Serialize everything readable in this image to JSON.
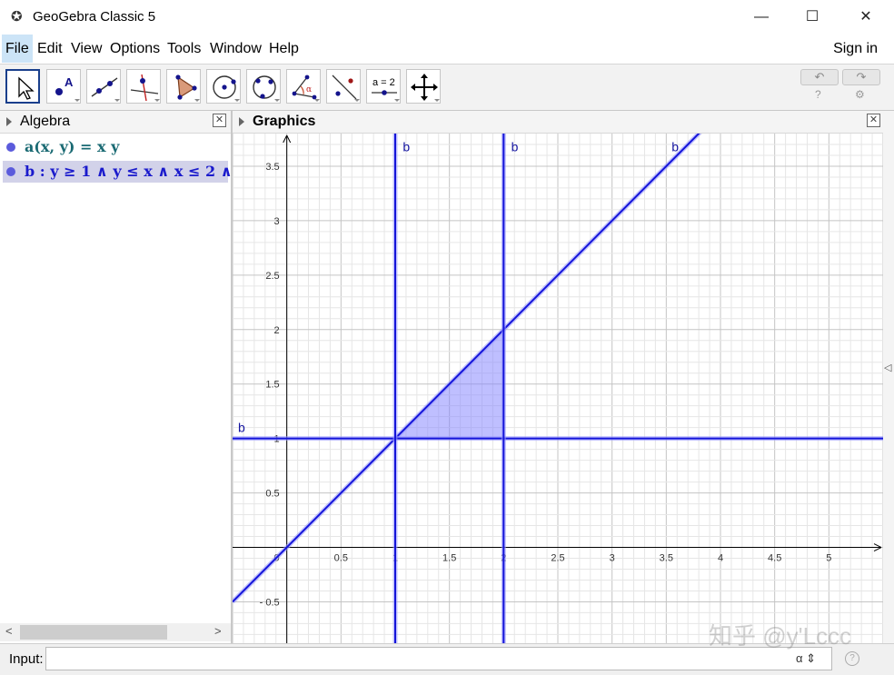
{
  "window": {
    "title": "GeoGebra Classic 5",
    "minimize": "—",
    "maximize": "☐",
    "close": "✕"
  },
  "menu": {
    "items": [
      "File",
      "Edit",
      "View",
      "Options",
      "Tools",
      "Window",
      "Help"
    ],
    "sign_in": "Sign in"
  },
  "toolbar": {
    "tools": [
      "move",
      "point",
      "line",
      "perpendicular-line",
      "polygon",
      "circle-center-point",
      "circle-three-points",
      "angle",
      "reflect",
      "slider",
      "move-graphics-view"
    ],
    "slider_label": "a = 2",
    "undo": "↶",
    "redo": "↷",
    "help_small": "?",
    "settings_small": "⚙"
  },
  "algebra": {
    "title": "Algebra",
    "close": "✕",
    "rows": [
      {
        "text": "a(x, y)  =  x y",
        "color": "#1a6a73"
      },
      {
        "text": "b : y ≥ 1 ∧ y ≤ x ∧ x ≤ 2 ∧",
        "color": "#1a1acc"
      }
    ],
    "scroll_left": "<",
    "scroll_right": ">"
  },
  "graphics": {
    "title": "Graphics",
    "close": "✕",
    "collapse": "◁",
    "object_label": "b"
  },
  "chart_data": {
    "type": "line",
    "xlim": [
      -0.5,
      5.5
    ],
    "ylim": [
      -0.88,
      3.8
    ],
    "x_ticks": [
      0.5,
      1,
      1.5,
      2,
      2.5,
      3,
      3.5,
      4,
      4.5,
      5
    ],
    "x_tick_labels": [
      "0.5",
      "1",
      "1.5",
      "2",
      "2.5",
      "3",
      "3.5",
      "4",
      "4.5",
      "5"
    ],
    "y_ticks": [
      -0.5,
      0.5,
      1,
      1.5,
      2,
      2.5,
      3,
      3.5
    ],
    "y_tick_labels": [
      "- 0.5",
      "0.5",
      "1",
      "1.5",
      "2",
      "2.5",
      "3",
      "3.5"
    ],
    "origin_label": "0",
    "grid": true,
    "series": [
      {
        "kind": "line",
        "points": [
          [
            -0.5,
            -0.5
          ],
          [
            5.5,
            5.5
          ]
        ]
      },
      {
        "kind": "hline",
        "y": 1
      },
      {
        "kind": "vline",
        "x": 1
      },
      {
        "kind": "vline",
        "x": 2
      }
    ],
    "region": {
      "vertices": [
        [
          1,
          1
        ],
        [
          2,
          2
        ],
        [
          2,
          1
        ]
      ],
      "color": "#8080ff"
    },
    "line_color": "#1414d9",
    "labels": [
      {
        "text": "b",
        "x": 1.07,
        "y": 3.68
      },
      {
        "text": "b",
        "x": 2.07,
        "y": 3.68
      },
      {
        "text": "b",
        "x": 3.55,
        "y": 3.68
      },
      {
        "text": "b",
        "x": -0.45,
        "y": 1.1
      }
    ]
  },
  "input": {
    "label": "Input:",
    "value": "",
    "placeholder": "",
    "alpha": "α ⇕",
    "help": "?"
  },
  "watermark": "知乎 @y'Lccc"
}
